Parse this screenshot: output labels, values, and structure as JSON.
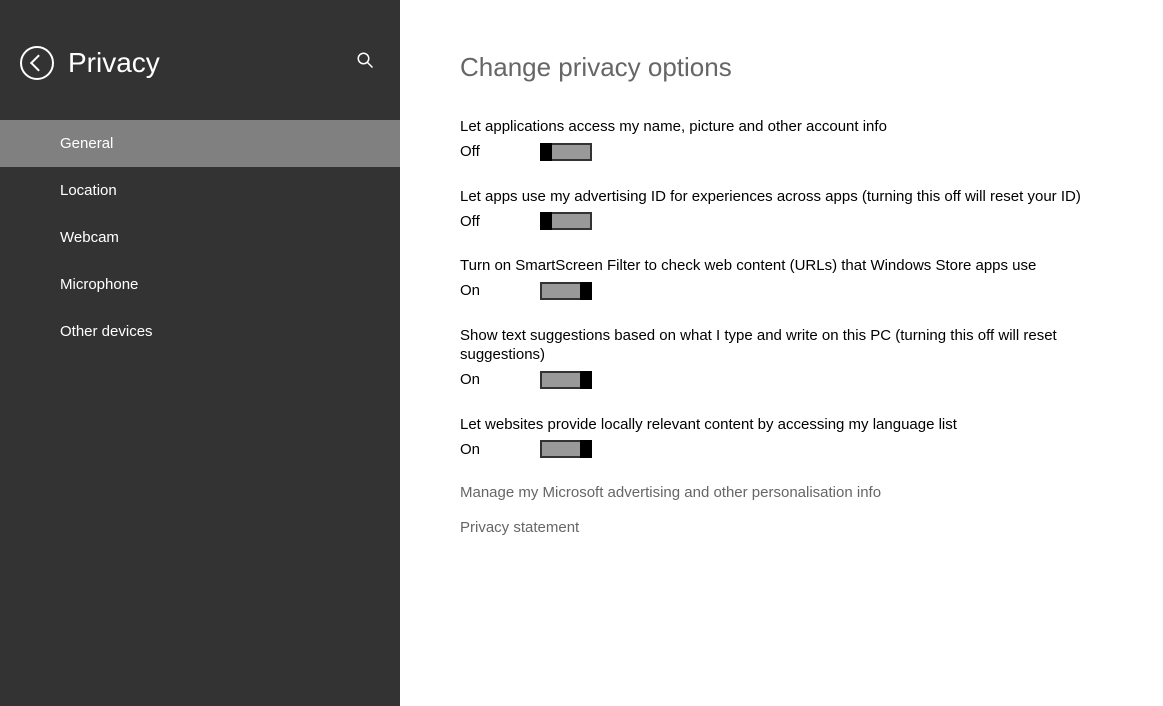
{
  "sidebar": {
    "title": "Privacy",
    "items": [
      {
        "label": "General",
        "active": true
      },
      {
        "label": "Location",
        "active": false
      },
      {
        "label": "Webcam",
        "active": false
      },
      {
        "label": "Microphone",
        "active": false
      },
      {
        "label": "Other devices",
        "active": false
      }
    ]
  },
  "content": {
    "title": "Change privacy options",
    "options": [
      {
        "label": "Let applications access my name, picture and other account info",
        "state": "Off",
        "on": false
      },
      {
        "label": "Let apps use my advertising ID for experiences across apps (turning this off will reset your ID)",
        "state": "Off",
        "on": false
      },
      {
        "label": "Turn on SmartScreen Filter to check web content (URLs) that Windows Store apps use",
        "state": "On",
        "on": true
      },
      {
        "label": "Show text suggestions based on what I type and write on this PC (turning this off will reset suggestions)",
        "state": "On",
        "on": true
      },
      {
        "label": "Let websites provide locally relevant content by accessing my language list",
        "state": "On",
        "on": true
      }
    ],
    "links": [
      "Manage my Microsoft advertising and other personalisation info",
      "Privacy statement"
    ]
  }
}
